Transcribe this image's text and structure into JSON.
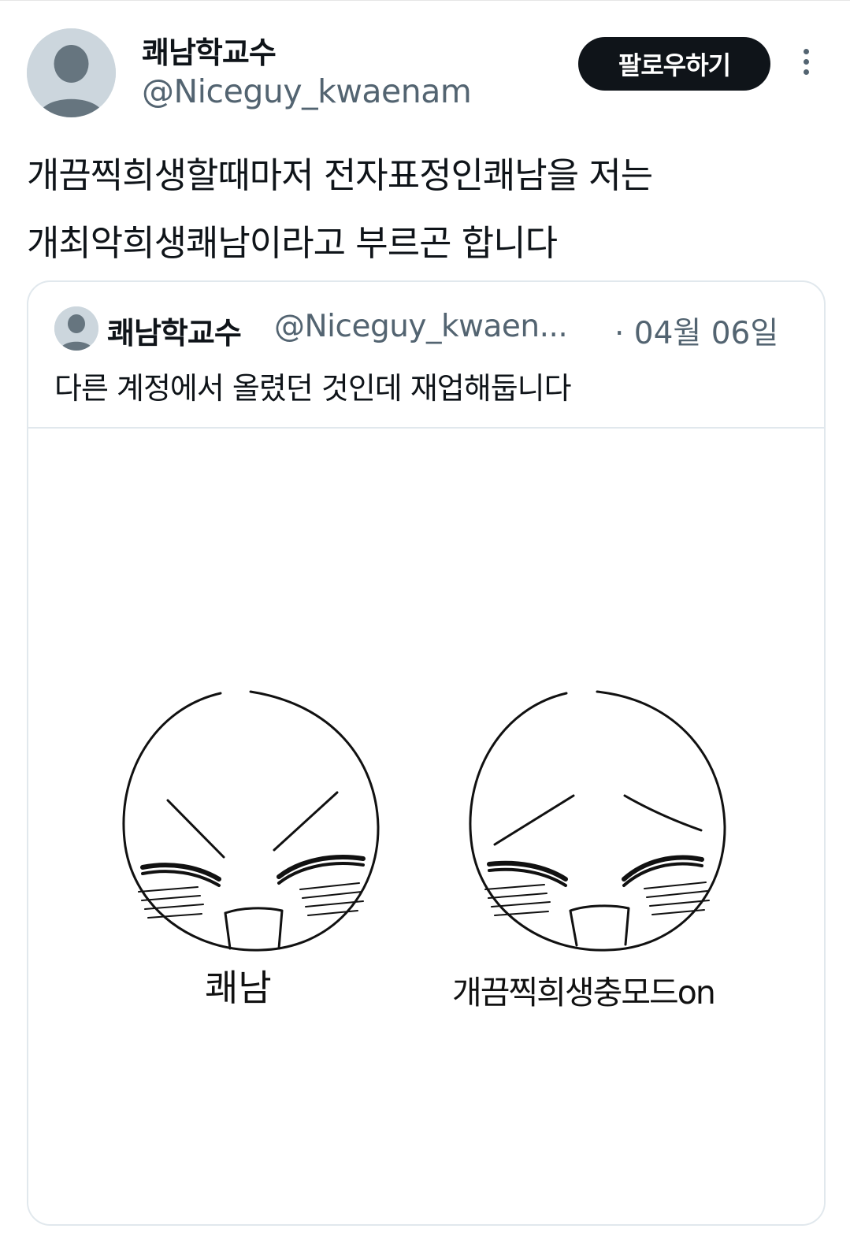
{
  "tweet": {
    "display_name": "쾌남학교수",
    "handle": "@Niceguy_kwaenam",
    "follow_label": "팔로우하기",
    "text_line1": "개끔찍희생할때마저 전자표정인쾌남을 저는",
    "text_line2": "개최악희생쾌남이라고 부르곤 합니다"
  },
  "quote": {
    "display_name": "쾌남학교수",
    "handle": "@Niceguy_kwaen...",
    "date": "· 04월 06일",
    "text": "다른 계정에서 올렸던 것인데 재업해둡니다"
  },
  "drawing": {
    "left_caption": "쾌남",
    "right_caption": "개끔찍희생충모드on"
  },
  "colors": {
    "text_primary": "#0f1419",
    "text_secondary": "#536471",
    "border": "#e1e8ed",
    "avatar_bg": "#ccd6dd"
  }
}
